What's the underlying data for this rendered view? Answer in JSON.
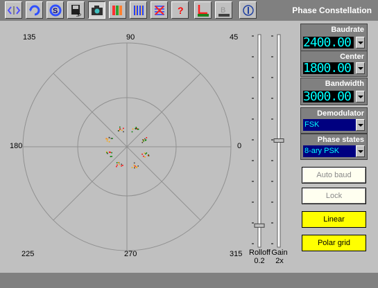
{
  "window": {
    "title": "Phase Constellation"
  },
  "toolbar": {
    "buttons": [
      {
        "icon": "code-view-icon"
      },
      {
        "icon": "refresh-icon"
      },
      {
        "icon": "sync-icon"
      },
      {
        "icon": "save-icon"
      },
      {
        "icon": "camera-icon"
      },
      {
        "icon": "color-bars-icon"
      },
      {
        "icon": "vertical-lines-icon"
      },
      {
        "icon": "grid-pattern-icon"
      },
      {
        "icon": "help-icon"
      },
      {
        "icon": "axis-graph-icon"
      },
      {
        "icon": "b-graph-icon"
      },
      {
        "icon": "info-icon"
      }
    ]
  },
  "plot": {
    "angle_labels": {
      "deg0": "0",
      "deg45": "45",
      "deg90": "90",
      "deg135": "135",
      "deg180": "180",
      "deg225": "225",
      "deg270": "270",
      "deg315": "315"
    },
    "colors": {
      "ring": "#909090",
      "points_a": "#008000",
      "points_b": "#ff0000",
      "points_c": "#ffa500"
    }
  },
  "sliders": {
    "rolloff": {
      "label": "Rolloff",
      "value": "0.2",
      "level": 0.1
    },
    "gain": {
      "label": "Gain",
      "value": "2x",
      "level": 0.5
    }
  },
  "controls": {
    "baudrate": {
      "label": "Baudrate",
      "value": "2400.00"
    },
    "center": {
      "label": "Center",
      "value": "1800.00"
    },
    "bandwidth": {
      "label": "Bandwidth",
      "value": "3000.00"
    },
    "demodulator": {
      "label": "Demodulator",
      "value": "FSK"
    },
    "phase_states": {
      "label": "Phase states",
      "value": "8-ary PSK"
    }
  },
  "buttons": {
    "auto_baud": "Auto baud",
    "lock": "Lock",
    "linear": "Linear",
    "polar_grid": "Polar grid"
  },
  "colors": {
    "accent": "#ffff00",
    "digits": "#00ffff",
    "header_bg": "#808080"
  }
}
